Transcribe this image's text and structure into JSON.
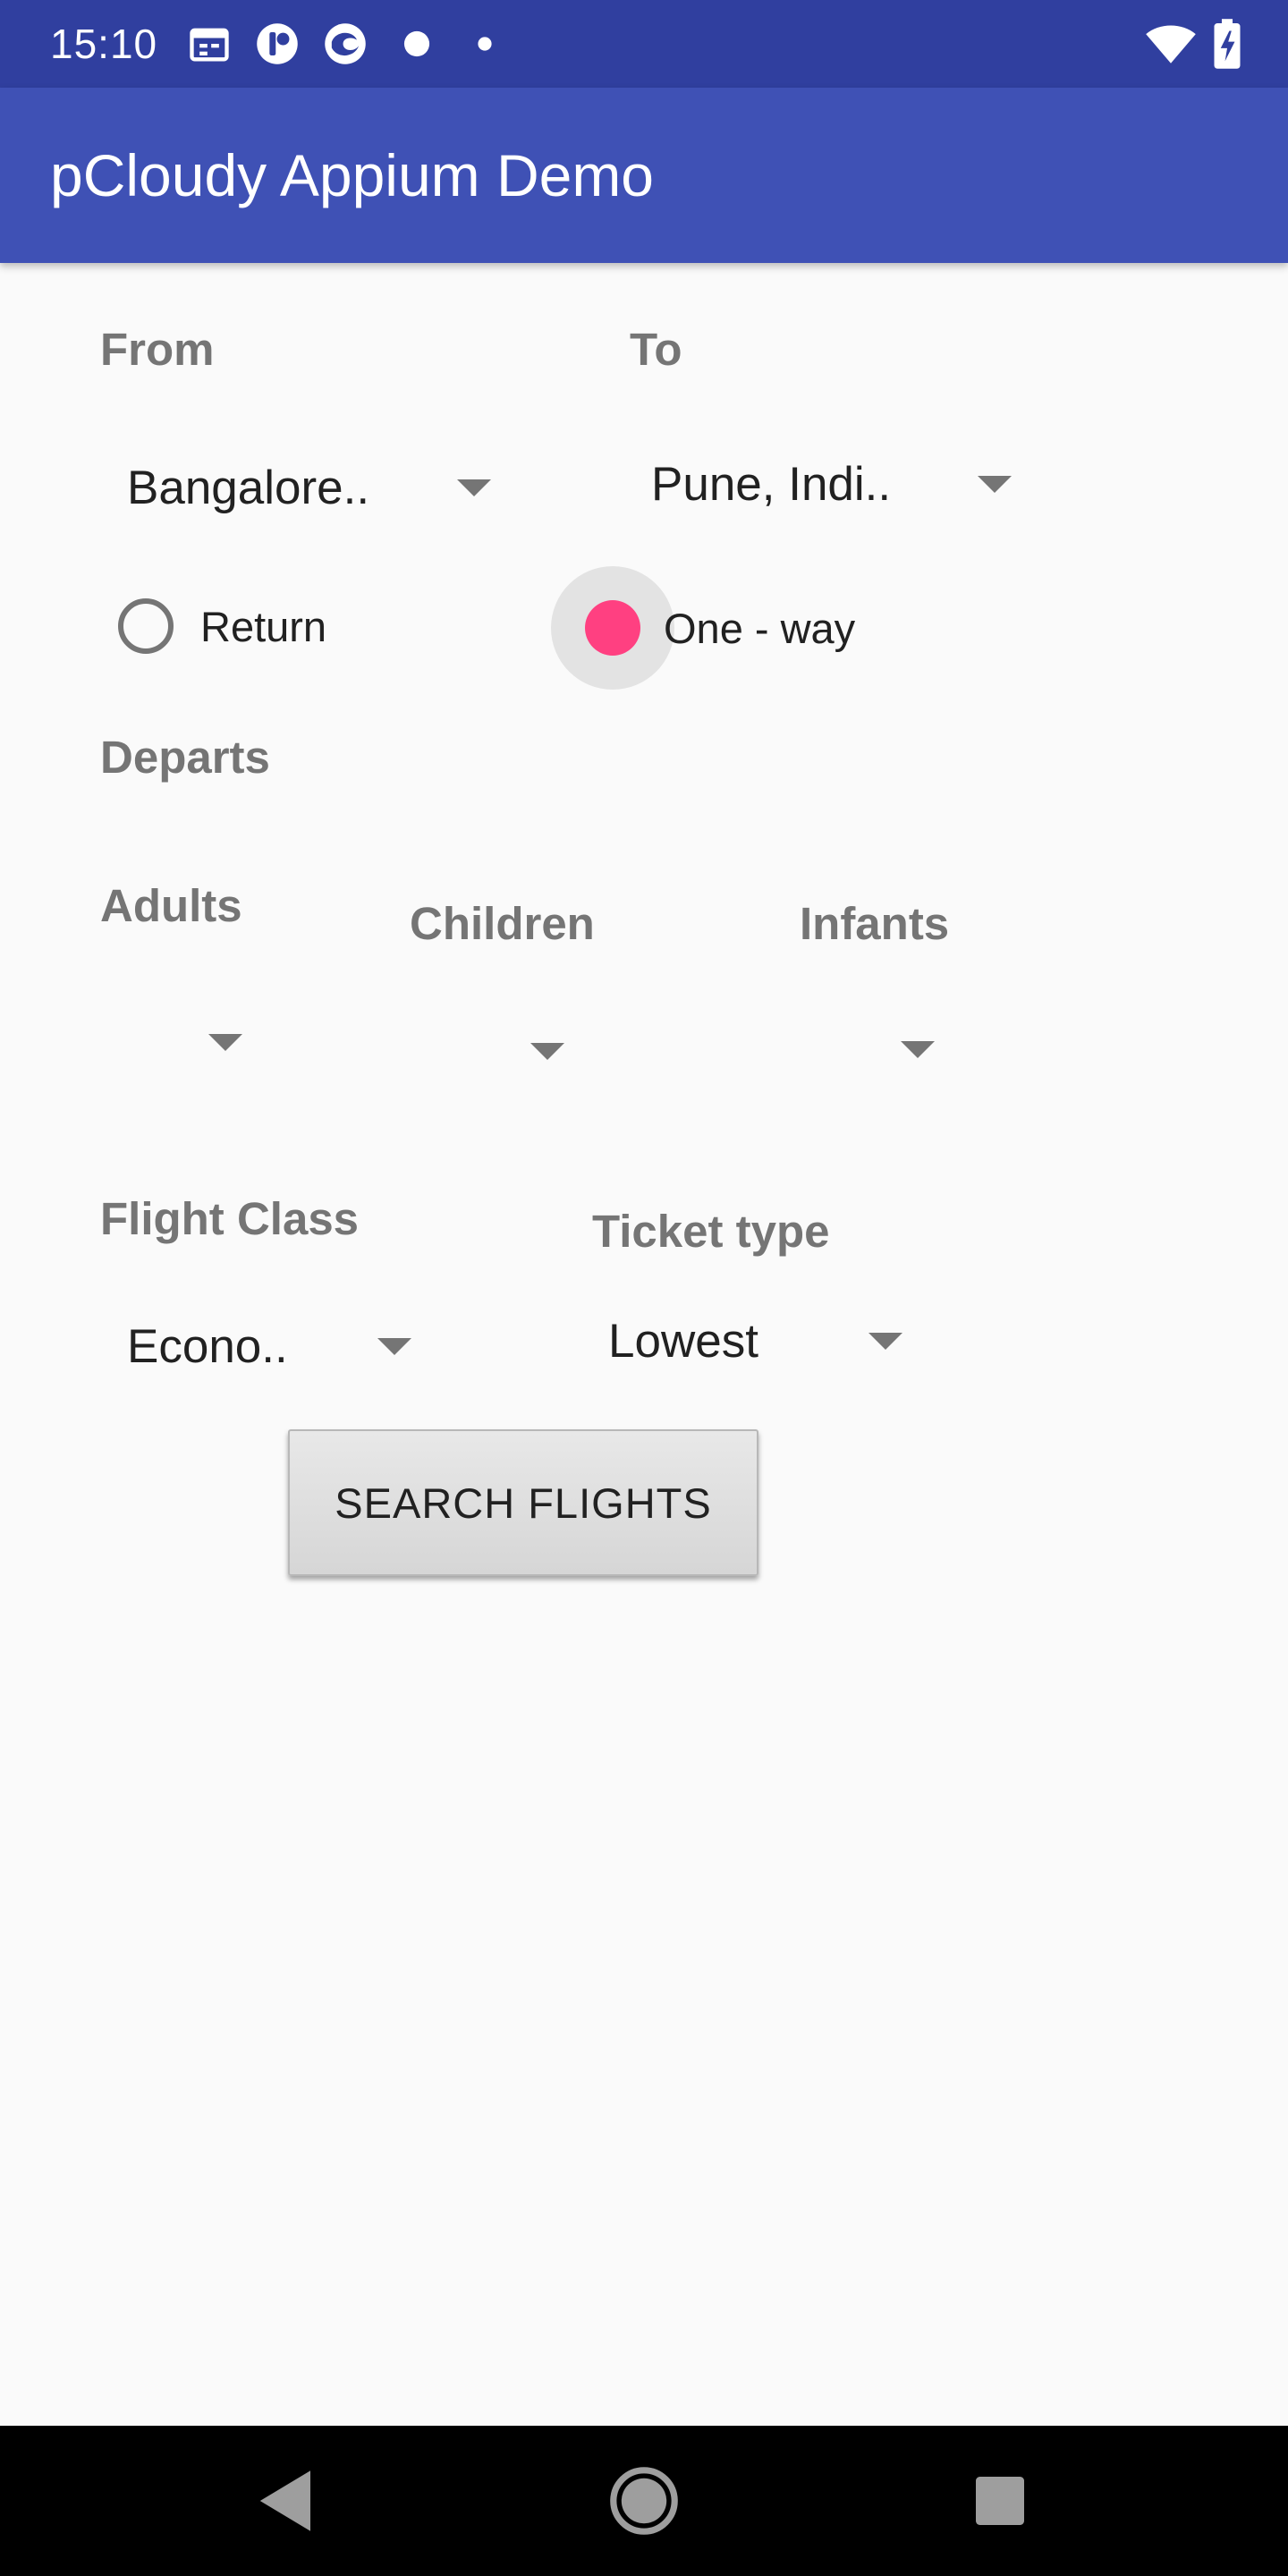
{
  "status_bar": {
    "time": "15:10",
    "icons": [
      "calendar-icon",
      "app-icon-r",
      "app-icon-swirl",
      "dot-icon",
      "small-dot-icon",
      "wifi-icon",
      "battery-charging-icon"
    ],
    "background_color": "#303f9f"
  },
  "app_bar": {
    "title": "pCloudy Appium Demo",
    "background_color": "#3f51b5"
  },
  "form": {
    "from": {
      "label": "From",
      "value": "Bangalore.."
    },
    "to": {
      "label": "To",
      "value": "Pune, Indi.."
    },
    "trip_type": {
      "options": [
        {
          "label": "Return",
          "selected": false
        },
        {
          "label": "One - way",
          "selected": true
        }
      ],
      "accent_color": "#ff4081"
    },
    "departs": {
      "label": "Departs"
    },
    "adults": {
      "label": "Adults",
      "value": ""
    },
    "children": {
      "label": "Children",
      "value": ""
    },
    "infants": {
      "label": "Infants",
      "value": ""
    },
    "flight_class": {
      "label": "Flight Class",
      "value": "Econo.."
    },
    "ticket_type": {
      "label": "Ticket type",
      "value": "Lowest"
    },
    "search_button": {
      "label": "SEARCH FLIGHTS"
    }
  },
  "nav_bar": {
    "icons": [
      "back-icon",
      "home-icon",
      "recents-icon"
    ]
  }
}
